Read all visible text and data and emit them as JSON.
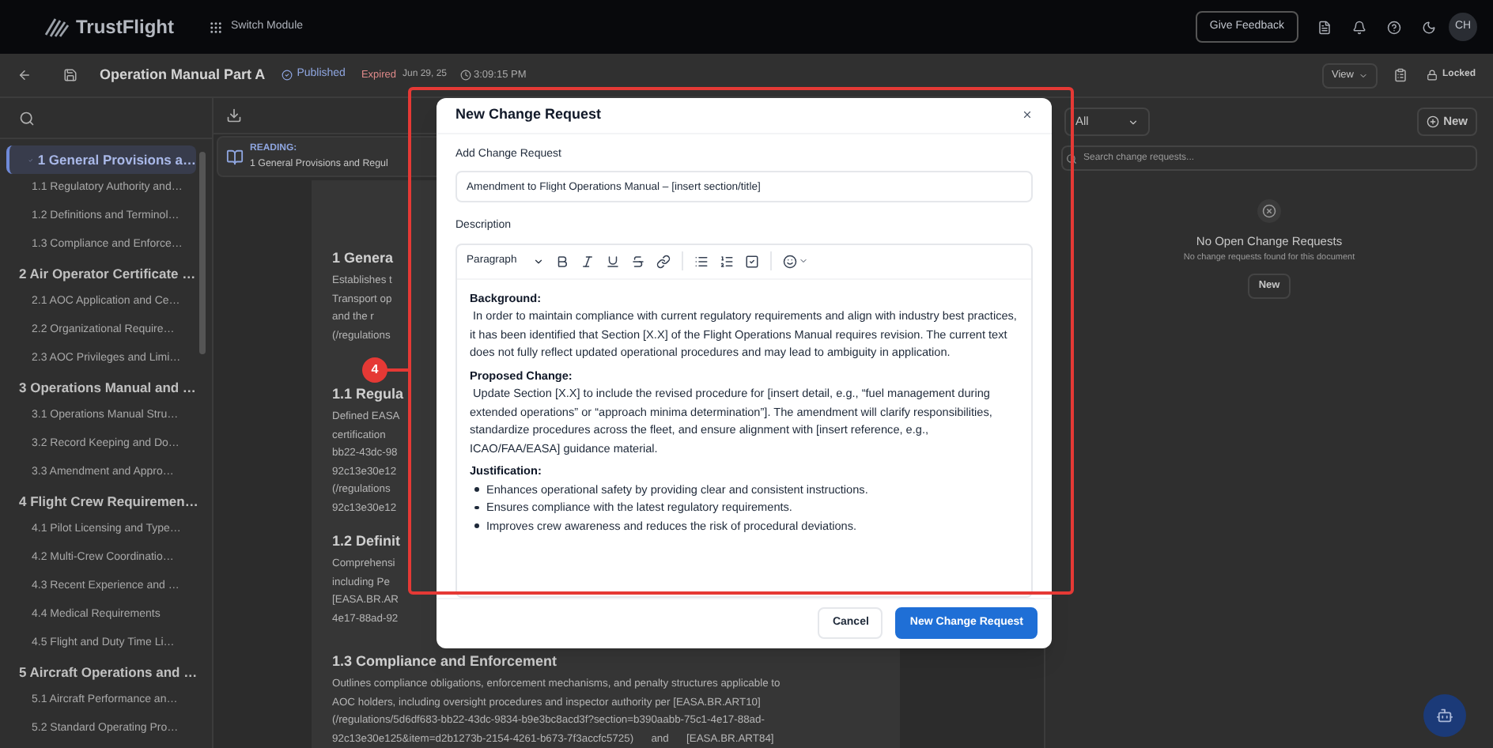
{
  "header": {
    "logo": "TrustFlight",
    "switch_module": "Switch Module",
    "feedback_button": "Give Feedback",
    "avatar": "CH"
  },
  "document_bar": {
    "title": "Operation Manual Part A",
    "status": "Published",
    "expiry": "Expired",
    "date": "Jun 29, 25",
    "time": "3:09:15 PM",
    "view_button": "View",
    "lock": "Locked"
  },
  "sidebar": {
    "items": [
      {
        "label": "1 General Provisions a…",
        "selected": true,
        "children": [
          {
            "label": "1.1 Regulatory Authority and…",
            "selected": false
          },
          {
            "label": "1.2 Definitions and Terminol…",
            "selected": false
          },
          {
            "label": "1.3 Compliance and Enforce…",
            "selected": false
          }
        ]
      },
      {
        "label": "2 Air Operator Certificate …",
        "selected": false,
        "children": [
          {
            "label": "2.1 AOC Application and Ce…",
            "selected": false
          },
          {
            "label": "2.2 Organizational Require…",
            "selected": false
          },
          {
            "label": "2.3 AOC Privileges and Limi…",
            "selected": false
          }
        ]
      },
      {
        "label": "3 Operations Manual and …",
        "selected": false,
        "children": [
          {
            "label": "3.1 Operations Manual Stru…",
            "selected": false
          },
          {
            "label": "3.2 Record Keeping and Do…",
            "selected": false
          },
          {
            "label": "3.3 Amendment and Appro…",
            "selected": false
          }
        ]
      },
      {
        "label": "4 Flight Crew Requiremen…",
        "selected": false,
        "children": [
          {
            "label": "4.1 Pilot Licensing and Type…",
            "selected": false
          },
          {
            "label": "4.2 Multi-Crew Coordinatio…",
            "selected": false
          },
          {
            "label": "4.3 Recent Experience and …",
            "selected": false
          },
          {
            "label": "4.4 Medical Requirements",
            "selected": false
          },
          {
            "label": "4.5 Flight and Duty Time Li…",
            "selected": false
          }
        ]
      },
      {
        "label": "5 Aircraft Operations and …",
        "selected": false,
        "children": [
          {
            "label": "5.1 Aircraft Performance an…",
            "selected": false
          },
          {
            "label": "5.2 Standard Operating Pro…",
            "selected": false
          }
        ]
      }
    ]
  },
  "reading": {
    "label": "READING:",
    "title": "1 General Provisions and Regul"
  },
  "document": {
    "sections": [
      {
        "heading": "1 Genera",
        "lines": [
          "Establishes t",
          "Transport op",
          "and the r",
          "(/regulations"
        ]
      },
      {
        "heading": "1.1 Regula",
        "lines": [
          "Defined EASA",
          "certification",
          "bb22-43dc-98",
          "92c13e30e12",
          "(/regulations",
          "92c13e30e12"
        ]
      },
      {
        "heading": "1.2 Definit",
        "lines": [
          "Comprehensi",
          "including Pe",
          "[EASA.BR.AR",
          "4e17-88ad-92"
        ]
      },
      {
        "heading": "1.3 Compliance and Enforcement",
        "lines": [
          "Outlines compliance obligations, enforcement mechanisms, and penalty structures applicable to",
          "AOC holders, including oversight procedures and inspector authority per [EASA.BR.ART10]",
          "(/regulations/5d6df683-bb22-43dc-9834-b9e3bc8acd3f?section=b390aabb-75c1-4e17-88ad-",
          "92c13e30e125&item=d2b1273b-2154-4261-b673-7f3accfc5725)      and      [EASA.BR.ART84]"
        ]
      }
    ]
  },
  "change_requests": {
    "filter": "All",
    "new_button": "New",
    "search": {
      "placeholder": "Search change requests..."
    },
    "empty_title": "No Open Change Requests",
    "empty_text": "No change requests found for this document",
    "empty_button": "New"
  },
  "modal": {
    "title": "New Change Request",
    "title_label": "Add Change Request",
    "title_value": "Amendment to Flight Operations Manual – [insert section/title]",
    "description_label": "Description",
    "block_type": "Paragraph",
    "content": [
      {
        "kind": "heading",
        "text": "Background:"
      },
      {
        "kind": "paragraph",
        "text": " In order to maintain compliance with current regulatory requirements and align with industry best practices, it has been identified that Section [X.X] of the Flight Operations Manual requires revision. The current text does not fully reflect updated operational procedures and may lead to ambiguity in application."
      },
      {
        "kind": "heading",
        "text": "Proposed Change:"
      },
      {
        "kind": "paragraph",
        "text": " Update Section [X.X] to include the revised procedure for [insert detail, e.g., “fuel management during extended operations” or “approach minima determination”]. The amendment will clarify responsibilities, standardize procedures across the fleet, and ensure alignment with [insert reference, e.g., ICAO/FAA/EASA] guidance material."
      },
      {
        "kind": "heading",
        "text": "Justification:"
      },
      {
        "kind": "bullets",
        "items": [
          "Enhances operational safety by providing clear and consistent instructions.",
          "Ensures compliance with the latest regulatory requirements.",
          "Improves crew awareness and reduces the risk of procedural deviations."
        ]
      }
    ],
    "buttons": [
      {
        "label": "Cancel",
        "kind": "secondary"
      },
      {
        "label": "New Change Request",
        "kind": "primary"
      }
    ]
  },
  "callout": {
    "number": "4"
  }
}
